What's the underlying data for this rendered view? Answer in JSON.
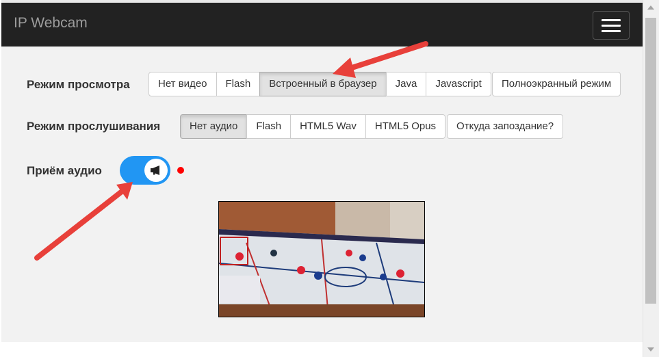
{
  "navbar": {
    "brand": "IP Webcam",
    "menu_icon": "hamburger-menu-icon"
  },
  "view_mode": {
    "label": "Режим просмотра",
    "options": [
      "Нет видео",
      "Flash",
      "Встроенный в браузер",
      "Java",
      "Javascript"
    ],
    "selected": "Встроенный в браузер",
    "fullscreen_label": "Полноэкранный режим"
  },
  "listen_mode": {
    "label": "Режим прослушивания",
    "options": [
      "Нет аудио",
      "Flash",
      "HTML5 Wav",
      "HTML5 Opus"
    ],
    "selected": "Нет аудио",
    "latency_label": "Откуда запоздание?"
  },
  "audio_receive": {
    "label": "Приём аудио",
    "toggle_on": true,
    "toggle_icon": "megaphone-icon",
    "indicator_color": "#ff0000"
  },
  "colors": {
    "navbar_bg": "#222222",
    "brand_text": "#9d9d9d",
    "toggle_accent": "#2196f3",
    "annotation_arrow": "#e8403a"
  }
}
